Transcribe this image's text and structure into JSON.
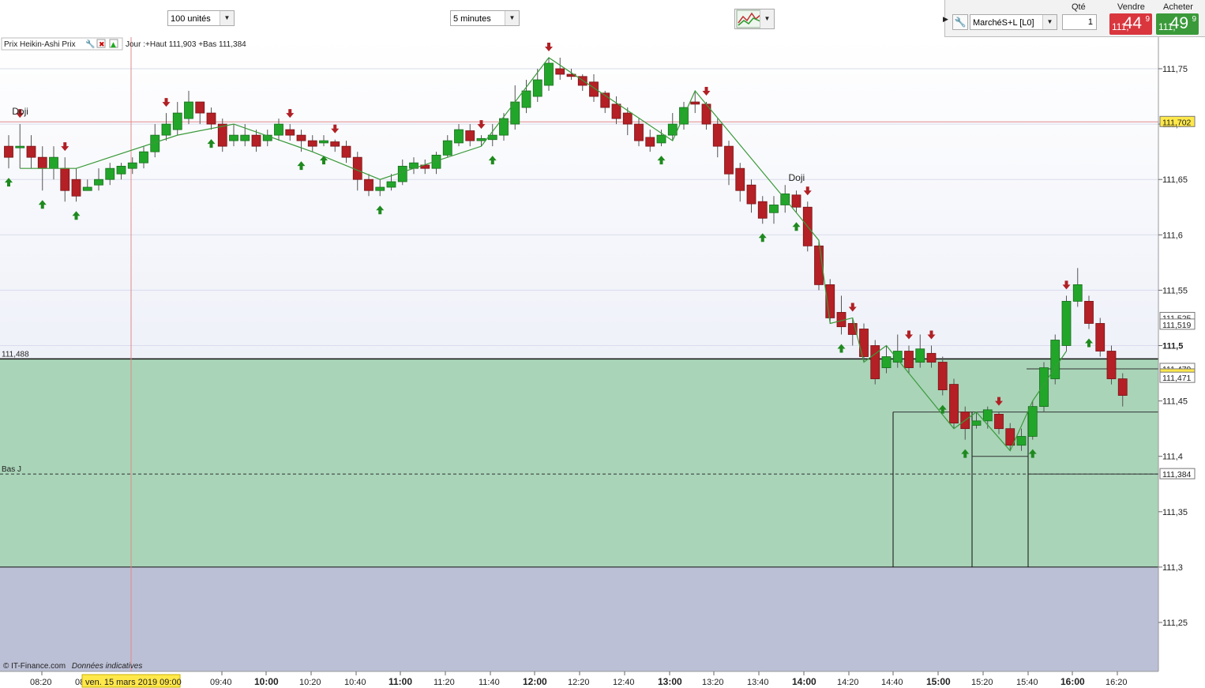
{
  "toolbar": {
    "units": "100 unités",
    "interval": "5 minutes",
    "chart_type_icon": "chart-type-icon"
  },
  "order_panel": {
    "instrument": "MarchéS+L [L0]",
    "qty_label": "Qté",
    "qty_value": "1",
    "sell_label": "Vendre",
    "buy_label": "Acheter",
    "sell_price_small": "111,",
    "sell_price_big": "44",
    "sell_price_sup": "9",
    "buy_price_small": "111,",
    "buy_price_big": "49",
    "buy_price_sup": "9",
    "sell_color": "#d9363e",
    "buy_color": "#3a9a3a"
  },
  "legend": {
    "indicator": "Prix Heikin-Ashi Prix",
    "day_info": "Jour :+Haut 111,903 +Bas 111,384"
  },
  "footer": {
    "copyright": "© IT-Finance.com",
    "disclaimer": "Données indicatives"
  },
  "chart_data": {
    "type": "candlestick",
    "y_ticks": [
      "111,75",
      "111,7",
      "111,65",
      "111,6",
      "111,55",
      "111,5",
      "111,45",
      "111,4",
      "111,35",
      "111,3",
      "111,25"
    ],
    "x_ticks": [
      "08:20",
      "09:40",
      "10:00",
      "10:20",
      "10:40",
      "11:00",
      "11:20",
      "11:40",
      "12:00",
      "12:20",
      "12:40",
      "13:00",
      "13:20",
      "13:40",
      "14:00",
      "14:20",
      "14:40",
      "15:00",
      "15:20",
      "15:40",
      "16:00",
      "16:20"
    ],
    "x_ticks_bold": [
      "10:00",
      "11:00",
      "12:00",
      "13:00",
      "14:00",
      "15:00",
      "16:00"
    ],
    "crosshair_date_label": "ven. 15 mars 2019 09:00",
    "crosshair_partial_label": "08",
    "ylim": [
      111.22,
      111.78
    ],
    "price_labels": [
      {
        "value": 111.702,
        "text": "111,702",
        "highlight": true
      },
      {
        "value": 111.525,
        "text": "111,525",
        "highlight": false
      },
      {
        "value": 111.519,
        "text": "111,519",
        "highlight": false
      },
      {
        "value": 111.479,
        "text": "111,479",
        "highlight": false
      },
      {
        "value": 111.474,
        "text": "111,474",
        "highlight": true
      },
      {
        "value": 111.471,
        "text": "111,471",
        "highlight": false
      },
      {
        "value": 111.384,
        "text": "111,384",
        "highlight": false
      }
    ],
    "left_labels": [
      {
        "value": 111.488,
        "text": "111,488"
      },
      {
        "value": 111.384,
        "text": "Bas J"
      }
    ],
    "annotations": [
      {
        "text": "Doji",
        "index": 1
      },
      {
        "text": "Doji",
        "index": 70
      }
    ],
    "zone_top": 111.488,
    "zone_bottom": 111.3,
    "up_color": "#22a62a",
    "down_color": "#b42025",
    "zone_color": "#a9d4b8",
    "candles": [
      [
        111.68,
        111.67,
        111.69,
        111.66
      ],
      [
        111.68,
        111.68,
        111.7,
        111.66
      ],
      [
        111.68,
        111.67,
        111.69,
        111.66
      ],
      [
        111.67,
        111.66,
        111.68,
        111.64
      ],
      [
        111.66,
        111.67,
        111.68,
        111.65
      ],
      [
        111.66,
        111.64,
        111.67,
        111.63
      ],
      [
        111.65,
        111.635,
        111.66,
        111.63
      ],
      [
        111.64,
        111.643,
        111.65,
        111.64
      ],
      [
        111.645,
        111.65,
        111.66,
        111.64
      ],
      [
        111.65,
        111.66,
        111.665,
        111.645
      ],
      [
        111.655,
        111.662,
        111.665,
        111.65
      ],
      [
        111.66,
        111.665,
        111.67,
        111.655
      ],
      [
        111.665,
        111.675,
        111.68,
        111.66
      ],
      [
        111.675,
        111.69,
        111.7,
        111.67
      ],
      [
        111.69,
        111.7,
        111.71,
        111.685
      ],
      [
        111.695,
        111.71,
        111.72,
        111.69
      ],
      [
        111.705,
        111.72,
        111.73,
        111.7
      ],
      [
        111.72,
        111.71,
        111.72,
        111.7
      ],
      [
        111.71,
        111.7,
        111.715,
        111.695
      ],
      [
        111.7,
        111.68,
        111.705,
        111.675
      ],
      [
        111.685,
        111.69,
        111.7,
        111.68
      ],
      [
        111.685,
        111.69,
        111.7,
        111.68
      ],
      [
        111.69,
        111.68,
        111.695,
        111.675
      ],
      [
        111.685,
        111.69,
        111.695,
        111.68
      ],
      [
        111.69,
        111.7,
        111.705,
        111.685
      ],
      [
        111.695,
        111.69,
        111.7,
        111.685
      ],
      [
        111.69,
        111.685,
        111.695,
        111.675
      ],
      [
        111.685,
        111.68,
        111.69,
        111.675
      ],
      [
        111.683,
        111.685,
        111.69,
        111.68
      ],
      [
        111.684,
        111.68,
        111.686,
        111.675
      ],
      [
        111.68,
        111.67,
        111.685,
        111.665
      ],
      [
        111.67,
        111.65,
        111.675,
        111.64
      ],
      [
        111.65,
        111.64,
        111.655,
        111.635
      ],
      [
        111.64,
        111.643,
        111.65,
        111.635
      ],
      [
        111.643,
        111.648,
        111.655,
        111.64
      ],
      [
        111.648,
        111.662,
        111.668,
        111.645
      ],
      [
        111.66,
        111.665,
        111.67,
        111.655
      ],
      [
        111.663,
        111.66,
        111.668,
        111.655
      ],
      [
        111.66,
        111.672,
        111.675,
        111.655
      ],
      [
        111.672,
        111.685,
        111.69,
        111.67
      ],
      [
        111.683,
        111.695,
        111.7,
        111.68
      ],
      [
        111.694,
        111.685,
        111.7,
        111.68
      ],
      [
        111.685,
        111.687,
        111.69,
        111.68
      ],
      [
        111.686,
        111.69,
        111.7,
        111.68
      ],
      [
        111.69,
        111.705,
        111.71,
        111.685
      ],
      [
        111.7,
        111.72,
        111.735,
        111.695
      ],
      [
        111.715,
        111.73,
        111.74,
        111.71
      ],
      [
        111.725,
        111.74,
        111.75,
        111.72
      ],
      [
        111.735,
        111.755,
        111.76,
        111.73
      ],
      [
        111.75,
        111.745,
        111.76,
        111.74
      ],
      [
        111.745,
        111.743,
        111.75,
        111.74
      ],
      [
        111.743,
        111.735,
        111.745,
        111.73
      ],
      [
        111.738,
        111.725,
        111.745,
        111.72
      ],
      [
        111.728,
        111.715,
        111.73,
        111.71
      ],
      [
        111.718,
        111.705,
        111.725,
        111.7
      ],
      [
        111.71,
        111.7,
        111.715,
        111.69
      ],
      [
        111.7,
        111.685,
        111.705,
        111.68
      ],
      [
        111.688,
        111.68,
        111.695,
        111.675
      ],
      [
        111.683,
        111.69,
        111.695,
        111.68
      ],
      [
        111.69,
        111.7,
        111.71,
        111.685
      ],
      [
        111.7,
        111.715,
        111.72,
        111.695
      ],
      [
        111.72,
        111.718,
        111.73,
        111.71
      ],
      [
        111.718,
        111.7,
        111.72,
        111.695
      ],
      [
        111.7,
        111.68,
        111.705,
        111.67
      ],
      [
        111.68,
        111.655,
        111.685,
        111.645
      ],
      [
        111.66,
        111.64,
        111.665,
        111.63
      ],
      [
        111.645,
        111.628,
        111.65,
        111.62
      ],
      [
        111.63,
        111.615,
        111.635,
        111.61
      ],
      [
        111.62,
        111.627,
        111.635,
        111.61
      ],
      [
        111.627,
        111.637,
        111.645,
        111.62
      ],
      [
        111.636,
        111.625,
        111.64,
        111.62
      ],
      [
        111.625,
        111.59,
        111.63,
        111.585
      ],
      [
        111.59,
        111.555,
        111.595,
        111.55
      ],
      [
        111.555,
        111.525,
        111.56,
        111.52
      ],
      [
        111.53,
        111.517,
        111.545,
        111.51
      ],
      [
        111.52,
        111.51,
        111.525,
        111.5
      ],
      [
        111.515,
        111.49,
        111.52,
        111.485
      ],
      [
        111.5,
        111.47,
        111.505,
        111.465
      ],
      [
        111.48,
        111.49,
        111.5,
        111.475
      ],
      [
        111.485,
        111.495,
        111.51,
        111.48
      ],
      [
        111.495,
        111.48,
        111.5,
        111.475
      ],
      [
        111.485,
        111.497,
        111.51,
        111.48
      ],
      [
        111.493,
        111.485,
        111.5,
        111.48
      ],
      [
        111.485,
        111.46,
        111.49,
        111.455
      ],
      [
        111.465,
        111.43,
        111.47,
        111.425
      ],
      [
        111.44,
        111.425,
        111.445,
        111.415
      ],
      [
        111.428,
        111.432,
        111.44,
        111.425
      ],
      [
        111.432,
        111.442,
        111.445,
        111.425
      ],
      [
        111.438,
        111.425,
        111.44,
        111.42
      ],
      [
        111.425,
        111.41,
        111.43,
        111.405
      ],
      [
        111.41,
        111.418,
        111.425,
        111.405
      ],
      [
        111.418,
        111.445,
        111.45,
        111.415
      ],
      [
        111.445,
        111.48,
        111.485,
        111.44
      ],
      [
        111.47,
        111.505,
        111.51,
        111.465
      ],
      [
        111.5,
        111.54,
        111.545,
        111.495
      ],
      [
        111.54,
        111.555,
        111.57,
        111.535
      ],
      [
        111.54,
        111.52,
        111.545,
        111.515
      ],
      [
        111.52,
        111.495,
        111.525,
        111.49
      ],
      [
        111.495,
        111.47,
        111.5,
        111.465
      ],
      [
        111.47,
        111.455,
        111.475,
        111.445
      ]
    ]
  }
}
